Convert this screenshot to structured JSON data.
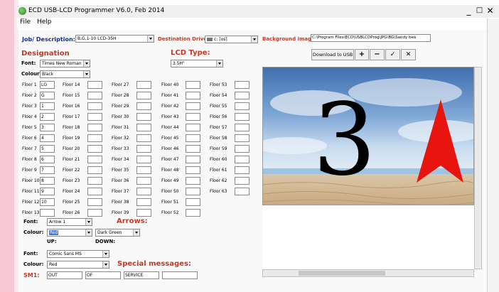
{
  "window": {
    "title": "ECD USB-LCD Programmer V6.0, Feb 2014",
    "controls": [
      "_",
      "□",
      "✕"
    ]
  },
  "menu": [
    "File",
    "Help"
  ],
  "top": {
    "job_label": "Job/ Description:",
    "job_value": "B,G,1-10 LCD-35H",
    "dest_label": "Destination Drive:",
    "dest_value": "c: [os]",
    "bg_label": "Background image:",
    "bg_value": "C:\\Program Files\\ECD\\USBLCDProg\\JPG\\BG\\Sandy bea"
  },
  "designation": {
    "heading": "Designation",
    "font_label": "Font:",
    "font_value": "Times New Roman",
    "colour_label": "Colour:",
    "colour_value": "Black"
  },
  "lcd": {
    "heading": "LCD Type:",
    "value": "3.5H\""
  },
  "buttons": {
    "download": "Download to USB",
    "plus": "+",
    "minus": "−",
    "check": "✓",
    "close": "✕"
  },
  "floors": {
    "col1": [
      {
        "label": "Floor 1",
        "value": "LG"
      },
      {
        "label": "Floor 2",
        "value": "G"
      },
      {
        "label": "Floor 3",
        "value": "1"
      },
      {
        "label": "Floor 4",
        "value": "2"
      },
      {
        "label": "Floor 5",
        "value": "3"
      },
      {
        "label": "Floor 6",
        "value": "4"
      },
      {
        "label": "Floor 7",
        "value": "5"
      },
      {
        "label": "Floor 8",
        "value": "6"
      },
      {
        "label": "Floor 9",
        "value": "7"
      },
      {
        "label": "Floor 10",
        "value": "8"
      },
      {
        "label": "Floor 11",
        "value": "9"
      },
      {
        "label": "Floor 12",
        "value": "10"
      },
      {
        "label": "Floor 13",
        "value": ""
      }
    ],
    "col2": [
      "Floor 14",
      "Floor 15",
      "Floor 16",
      "Floor 17",
      "Floor 18",
      "Floor 19",
      "Floor 20",
      "Floor 21",
      "Floor 22",
      "Floor 23",
      "Floor 24",
      "Floor 25",
      "Floor 26"
    ],
    "col3": [
      "Floor 27",
      "Floor 28",
      "Floor 29",
      "Floor 30",
      "Floor 31",
      "Floor 32",
      "Floor 33",
      "Floor 34",
      "Floor 35",
      "Floor 36",
      "Floor 37",
      "Floor 38",
      "Floor 39"
    ],
    "col4": [
      "Floor 40",
      "Floor 41",
      "Floor 42",
      "Floor 43",
      "Floor 44",
      "Floor 45",
      "Floor 46",
      "Floor 47",
      "Floor 48",
      "Floor 49",
      "Floor 50",
      "Floor 51",
      "Floor 52"
    ],
    "col5": [
      "Floor 53",
      "Floor 54",
      "Floor 55",
      "Floor 56",
      "Floor 57",
      "Floor 58",
      "Floor 59",
      "Floor 60",
      "Floor 61",
      "Floor 62",
      "Floor 63"
    ]
  },
  "arrows": {
    "font_label": "Font:",
    "font_value": "Arrow 1",
    "heading": "Arrows:",
    "colour_label": "Colour:",
    "up_colour": "Red",
    "down_colour": "Dark Green",
    "up_label": "UP:",
    "down_label": "DOWN:"
  },
  "special": {
    "font_label": "Font:",
    "font_value": "Comic Sans MS",
    "colour_label": "Colour:",
    "colour_value": "Red",
    "heading": "Special messages:",
    "sm1_label": "SM1:",
    "sm_values": [
      "OUT",
      "OF",
      "SERVICE",
      ""
    ]
  },
  "preview": {
    "floor_number": "3",
    "arrow_color": "#e8150f"
  }
}
